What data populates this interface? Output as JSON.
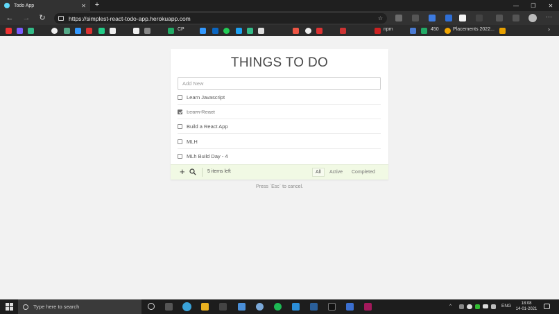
{
  "browser": {
    "tab_title": "Todo App",
    "tab_close": "✕",
    "new_tab": "+",
    "url": "https://simplest-react-todo-app.herokuapp.com",
    "back": "←",
    "forward": "→",
    "reload": "↻",
    "bookmark_star": "☆",
    "window_minimize": "—",
    "window_restore": "❐",
    "window_close": "✕",
    "bookmarks": {
      "cp": "CP",
      "npm": "npm",
      "count_450": "450",
      "placements": "Placements 2022...",
      "more": "›"
    }
  },
  "app": {
    "heading": "THINGS TO DO",
    "add_placeholder": "Add New",
    "todos": [
      {
        "label": "Learn Javascript",
        "done": false
      },
      {
        "label": "Learn React",
        "done": true
      },
      {
        "label": "Build a React App",
        "done": false
      },
      {
        "label": "MLH",
        "done": false
      },
      {
        "label": "MLh Build Day - 4",
        "done": false
      }
    ],
    "footer": {
      "add_icon": "+",
      "items_left": "5 items left",
      "filters": [
        "All",
        "Active",
        "Completed"
      ],
      "active_filter": "All"
    },
    "hint": "Press `Esc` to cancel."
  },
  "taskbar": {
    "search_placeholder": "Type here to search",
    "lang": "ENG",
    "time": "18:08",
    "date": "14-01-2021"
  },
  "colors": {
    "footer_bg": "#f1f9e4",
    "page_bg": "#f2f2f2",
    "chrome_dark": "#323232"
  }
}
